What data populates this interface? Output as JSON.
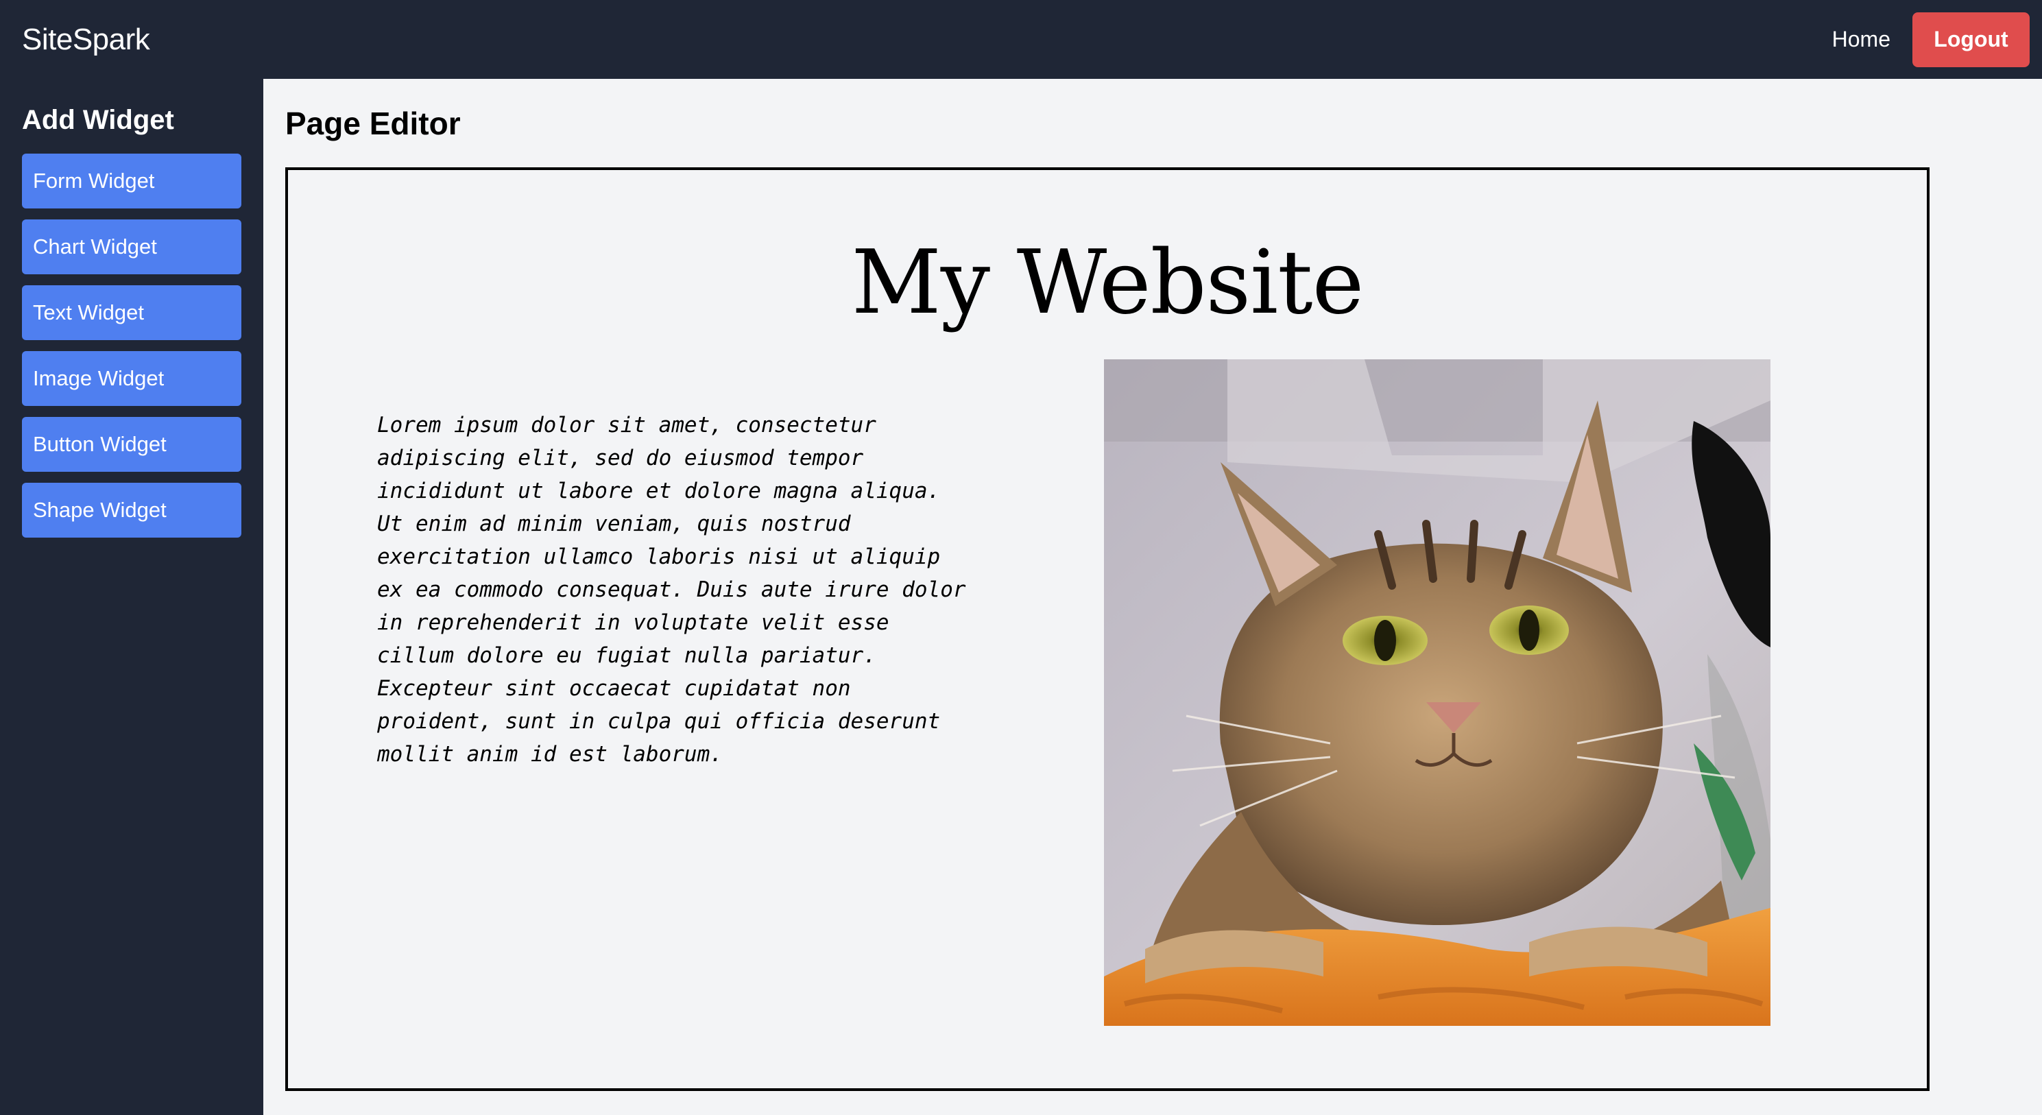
{
  "topbar": {
    "brand": "SiteSpark",
    "home_label": "Home",
    "logout_label": "Logout",
    "logout_color": "#e04d4d",
    "background": "#1f2636"
  },
  "sidebar": {
    "title": "Add Widget",
    "accent": "#4f7ff0",
    "items": [
      {
        "label": "Form Widget"
      },
      {
        "label": "Chart Widget"
      },
      {
        "label": "Text Widget"
      },
      {
        "label": "Image Widget"
      },
      {
        "label": "Button Widget"
      },
      {
        "label": "Shape Widget"
      }
    ]
  },
  "main": {
    "heading": "Page Editor",
    "canvas": {
      "site_title": "My Website",
      "body_text": "Lorem ipsum dolor sit amet, consectetur adipiscing elit, sed do eiusmod tempor incididunt ut labore et dolore magna aliqua. Ut enim ad minim veniam, quis nostrud exercitation ullamco laboris nisi ut aliquip ex ea commodo consequat. Duis aute irure dolor in reprehenderit in voluptate velit esse cillum dolore eu fugiat nulla pariatur. Excepteur sint occaecat cupidatat non proident, sunt in culpa qui officia deserunt mollit anim id est laborum.",
      "image_subject": "tabby-cat-photo"
    }
  }
}
